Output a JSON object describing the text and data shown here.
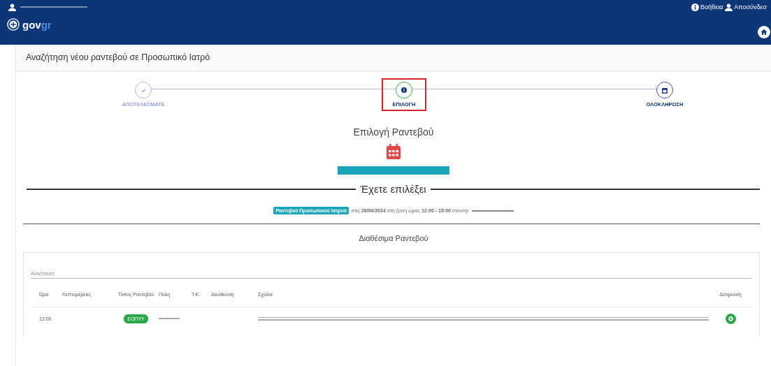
{
  "header": {
    "logo": {
      "prefix": "gov",
      "suffix": "gr"
    },
    "links": [
      {
        "kind": "help",
        "label": "Βοήθεια"
      },
      {
        "kind": "user",
        "label": "Αποσύνδεσ"
      }
    ]
  },
  "page_title": "Αναζήτηση νέου ραντεβού σε Προσωπικό Ιατρό",
  "steps": [
    {
      "label": "ΑΠΟΤΕΛΕΣΜΑΤΑ",
      "kind": "done",
      "highlighted": false
    },
    {
      "label": "ΕΠΙΛΟΓΗ",
      "kind": "current",
      "highlighted": true
    },
    {
      "label": "ΟΛΟΚΛΗΡΩΣΗ",
      "kind": "pending",
      "highlighted": false
    }
  ],
  "section_title": "Επιλογή Ραντεβού",
  "progress": {
    "level": 1
  },
  "selection": {
    "heading": "Έχετε επιλέξει",
    "badge": "Ραντεβού Προσωπικού Ιατρού",
    "summary": "στις **26/04/2024** στη ζώνη ώρας **12:00 - 15:00** στον/ην"
  },
  "available": {
    "title": "Διαθέσιμα Ραντεβού",
    "search": {
      "placeholder": "Αναζήτηση"
    },
    "columns": [
      "Ώρα",
      "Λεπτομέρειες",
      "Τύπος Ραντεβού",
      "Πόλη",
      "Τ.Κ.",
      "Διεύθυνση",
      "Σχόλια",
      "Δέσμευση"
    ],
    "rows": [
      {
        "time": "12:00",
        "type": "ΕΟΠΥΥ"
      }
    ]
  }
}
